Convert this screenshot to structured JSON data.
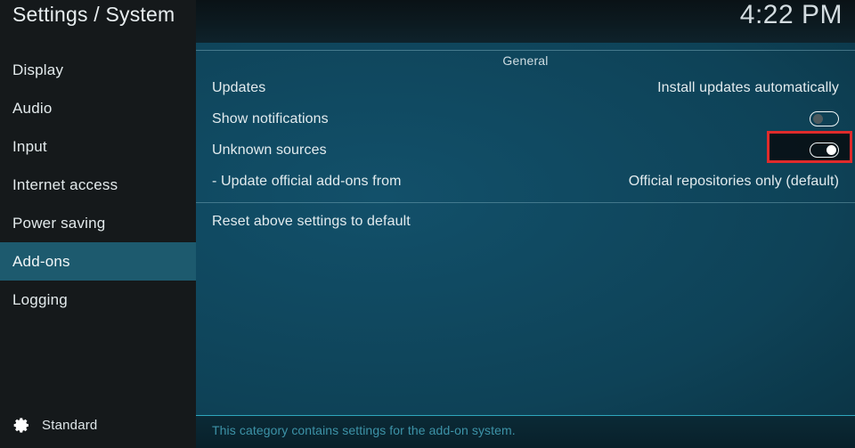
{
  "header": {
    "title": "Settings / System",
    "clock": "4:22 PM"
  },
  "sidebar": {
    "items": [
      {
        "label": "Display",
        "selected": false
      },
      {
        "label": "Audio",
        "selected": false
      },
      {
        "label": "Input",
        "selected": false
      },
      {
        "label": "Internet access",
        "selected": false
      },
      {
        "label": "Power saving",
        "selected": false
      },
      {
        "label": "Add-ons",
        "selected": true
      },
      {
        "label": "Logging",
        "selected": false
      }
    ],
    "footer": {
      "icon": "gear-icon",
      "label": "Standard"
    }
  },
  "main": {
    "group_title": "General",
    "settings": [
      {
        "label": "Updates",
        "type": "value",
        "value": "Install updates automatically"
      },
      {
        "label": "Show notifications",
        "type": "toggle",
        "state": "off",
        "highlighted": false
      },
      {
        "label": "Unknown sources",
        "type": "toggle",
        "state": "on",
        "highlighted": true
      },
      {
        "label": "- Update official add-ons from",
        "type": "value",
        "value": "Official repositories only (default)"
      },
      {
        "label": "Reset above settings to default",
        "type": "action",
        "value": ""
      }
    ],
    "description": "This category contains settings for the add-on system."
  },
  "colors": {
    "accent_teal": "#1d5a6e",
    "panel_teal": "#0e4257",
    "highlight_red": "#e02b2b",
    "desc_text": "#3d93a8",
    "separator": "#2fa7bd"
  }
}
